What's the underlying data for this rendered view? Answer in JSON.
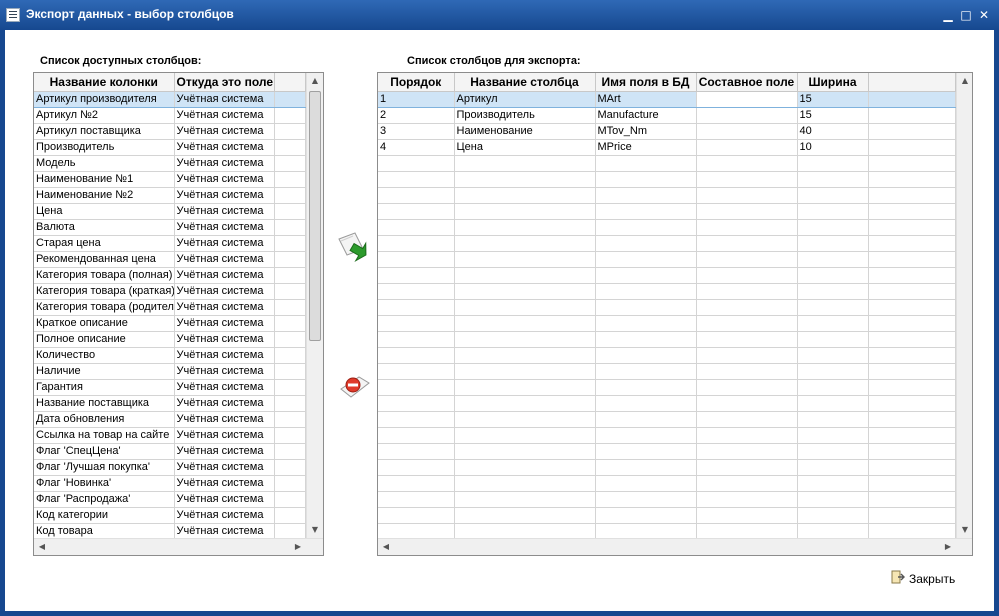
{
  "window": {
    "title": "Экспорт данных - выбор столбцов",
    "controls": {
      "minimize": "▁",
      "maximize": "□",
      "close": "✕"
    }
  },
  "available": {
    "label": "Список доступных столбцов:",
    "headers": [
      "Название колонки",
      "Откуда это поле"
    ],
    "rows": [
      [
        "Артикул производителя",
        "Учётная система"
      ],
      [
        "Артикул №2",
        "Учётная система"
      ],
      [
        "Артикул поставщика",
        "Учётная система"
      ],
      [
        "Производитель",
        "Учётная система"
      ],
      [
        "Модель",
        "Учётная система"
      ],
      [
        "Наименование №1",
        "Учётная система"
      ],
      [
        "Наименование №2",
        "Учётная система"
      ],
      [
        "Цена",
        "Учётная система"
      ],
      [
        "Валюта",
        "Учётная система"
      ],
      [
        "Старая цена",
        "Учётная система"
      ],
      [
        "Рекомендованная цена",
        "Учётная система"
      ],
      [
        "Категория товара (полная)",
        "Учётная система"
      ],
      [
        "Категория товара (краткая)",
        "Учётная система"
      ],
      [
        "Категория товара (родитель)",
        "Учётная система"
      ],
      [
        "Краткое описание",
        "Учётная система"
      ],
      [
        "Полное описание",
        "Учётная система"
      ],
      [
        "Количество",
        "Учётная система"
      ],
      [
        "Наличие",
        "Учётная система"
      ],
      [
        "Гарантия",
        "Учётная система"
      ],
      [
        "Название поставщика",
        "Учётная система"
      ],
      [
        "Дата обновления",
        "Учётная система"
      ],
      [
        "Ссылка на товар на сайте",
        "Учётная система"
      ],
      [
        "Флаг 'СпецЦена'",
        "Учётная система"
      ],
      [
        "Флаг 'Лучшая покупка'",
        "Учётная система"
      ],
      [
        "Флаг 'Новинка'",
        "Учётная система"
      ],
      [
        "Флаг 'Распродажа'",
        "Учётная система"
      ],
      [
        "Код категории",
        "Учётная система"
      ],
      [
        "Код товара",
        "Учётная система"
      ]
    ]
  },
  "export": {
    "label": "Список столбцов для экспорта:",
    "headers": [
      "Порядок",
      "Название столбца",
      "Имя поля в БД",
      "Составное поле",
      "Ширина"
    ],
    "rows": [
      [
        "1",
        "Артикул",
        "MArt",
        "",
        "15"
      ],
      [
        "2",
        "Производитель",
        "Manufacture",
        "",
        "15"
      ],
      [
        "3",
        "Наименование",
        "MTov_Nm",
        "",
        "40"
      ],
      [
        "4",
        "Цена",
        "MPrice",
        "",
        "10"
      ]
    ]
  },
  "actions": {
    "add_icon": "add-to-export-icon",
    "remove_icon": "remove-from-export-icon"
  },
  "footer": {
    "close_label": "Закрыть"
  }
}
